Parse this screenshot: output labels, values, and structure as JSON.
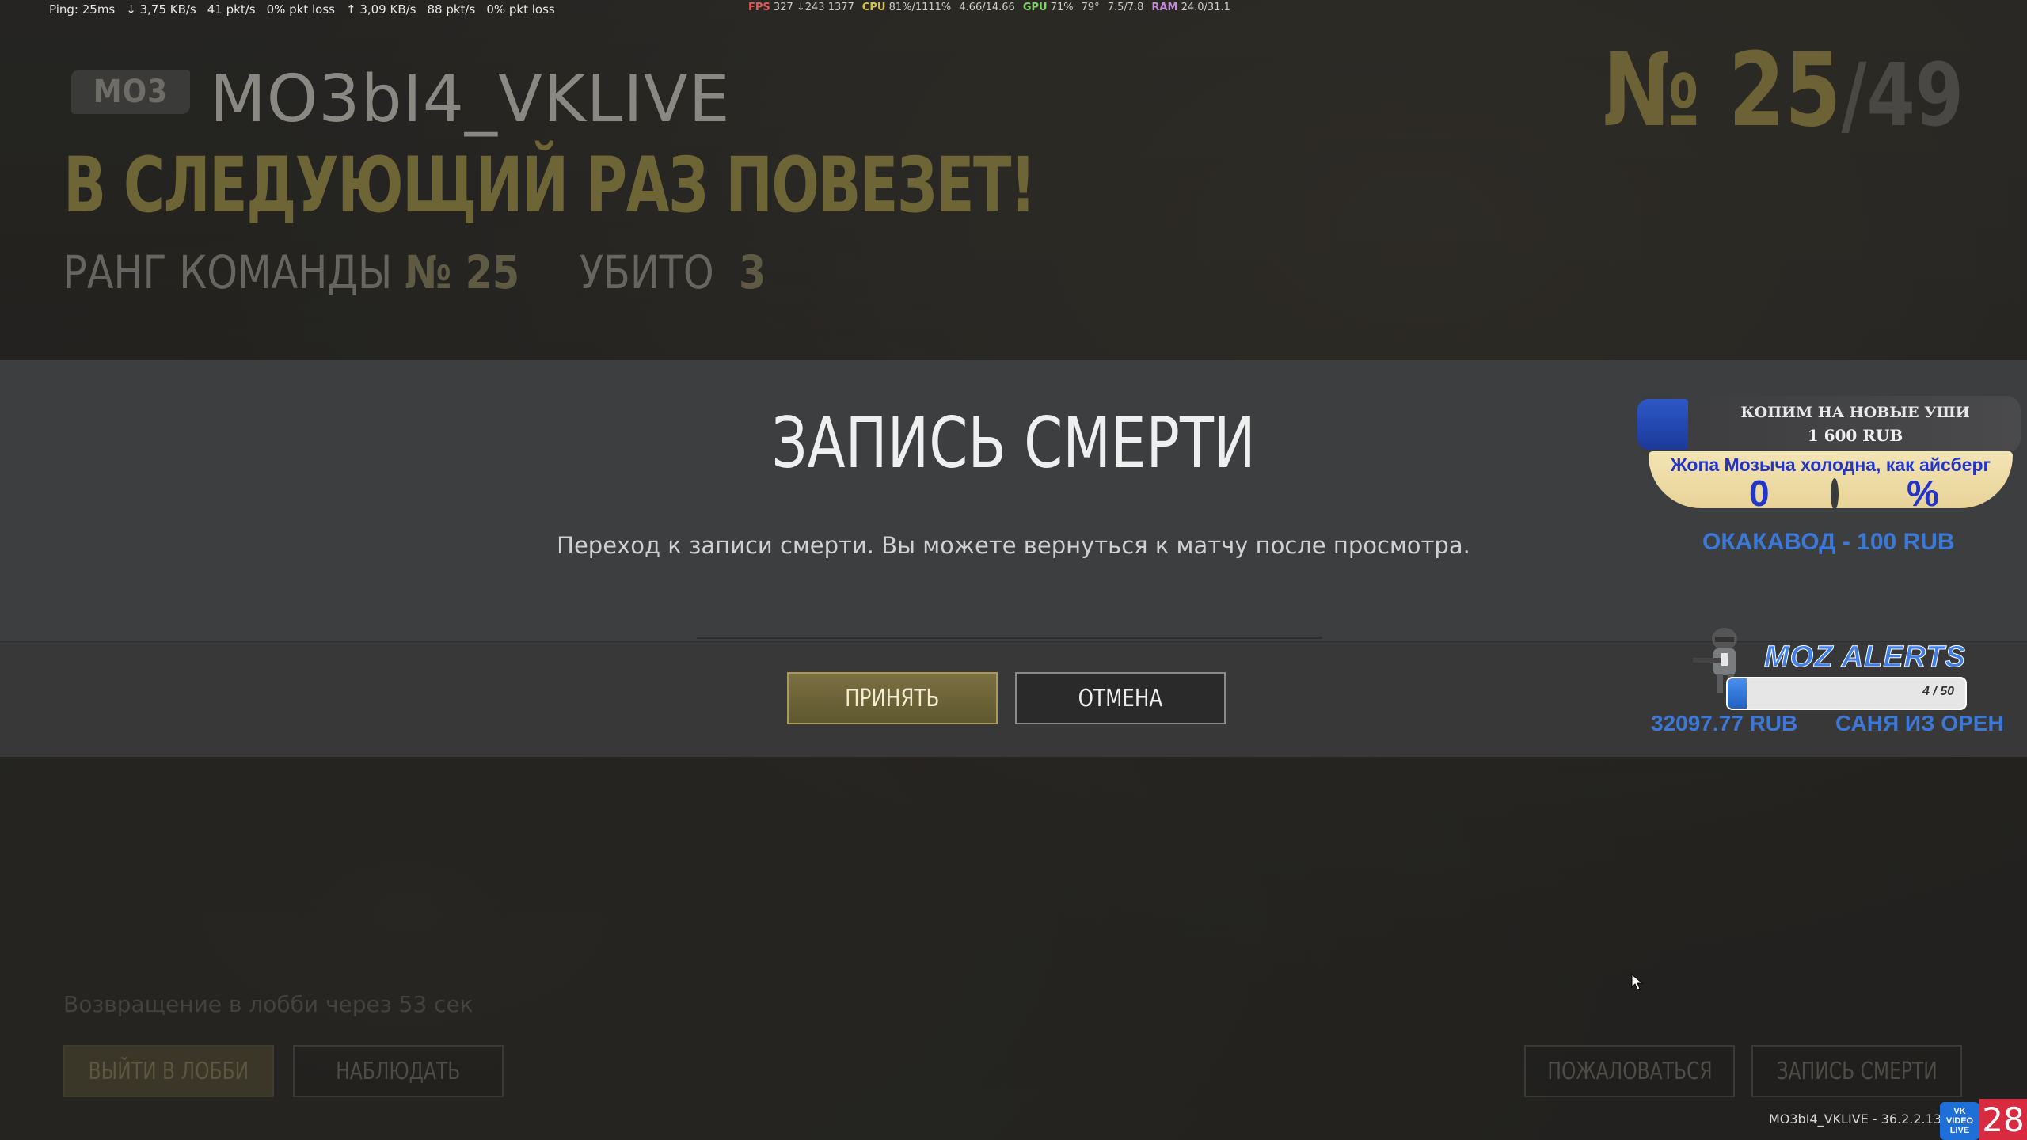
{
  "stats": {
    "ping": "Ping: 25ms",
    "down_rate": "↓ 3,75 KB/s",
    "down_pkts": "41 pkt/s",
    "down_loss": "0% pkt loss",
    "up_rate": "↑ 3,09 KB/s",
    "up_pkts": "88 pkt/s",
    "up_loss": "0% pkt loss",
    "fps_label": "FPS",
    "fps_value": "327 ↓243 1377",
    "cpu_label": "CPU",
    "cpu_value": "81%/1111%",
    "cpu_freq": "4.66/14.66",
    "gpu_label": "GPU",
    "gpu_value": "71%",
    "gpu_temp": "79°",
    "gpu_mem": "7.5/7.8",
    "ram_label": "RAM",
    "ram_value": "24.0/31.1"
  },
  "header": {
    "clan_tag": "MO3",
    "player_name": "MO3bI4_VKLIVE",
    "banner": "В СЛЕДУЮЩИЙ РАЗ ПОВЕЗЕТ!",
    "team_rank_label": "РАНГ КОМАНДЫ",
    "team_rank_value": "№ 25",
    "kills_label": "УБИТО",
    "kills_value": "3",
    "place_prefix": "№",
    "place": "25",
    "place_total": "/49"
  },
  "modal": {
    "title": "ЗАПИСЬ СМЕРТИ",
    "text": "Переход к записи смерти. Вы можете вернуться к матчу после просмотра.",
    "accept_label": "ПРИНЯТЬ",
    "cancel_label": "ОТМЕНА"
  },
  "footer": {
    "return_text": "Возвращение в лобби через 53 сек",
    "exit_label": "ВЫЙТИ В ЛОББИ",
    "spectate_label": "НАБЛЮДАТЬ",
    "report_label": "ПОЖАЛОВАТЬСЯ",
    "deathcam_label": "ЗАПИСЬ СМЕРТИ"
  },
  "widgets": {
    "goal_title": "КОПИМ НА НОВЫЕ УШИ",
    "goal_amount": "1 600 RUB",
    "goal_caption": "Жопа Мозыча холодна, как айсберг",
    "goal_left": "0",
    "goal_right": "%",
    "goal_progress": 0.2,
    "alert_note": "ОКАКАВОД - 100 RUB",
    "moz_title": "MOZ ALERTS",
    "moz_count": "4 / 50",
    "moz_progress": 0.08,
    "ticker_amount": "32097.77 RUB",
    "ticker_name": "САНЯ ИЗ ОРЕН"
  },
  "watermark": {
    "text": "MO3bI4_VKLIVE - 36.2.2.13",
    "vk_line1": "VK",
    "vk_line2": "VIDEO",
    "vk_line3": "LIVE",
    "age": "28"
  },
  "colors": {
    "accent_gold": "#7a7042",
    "alert_blue": "#3b78d8",
    "goal_caption_text": "#2335c8"
  }
}
